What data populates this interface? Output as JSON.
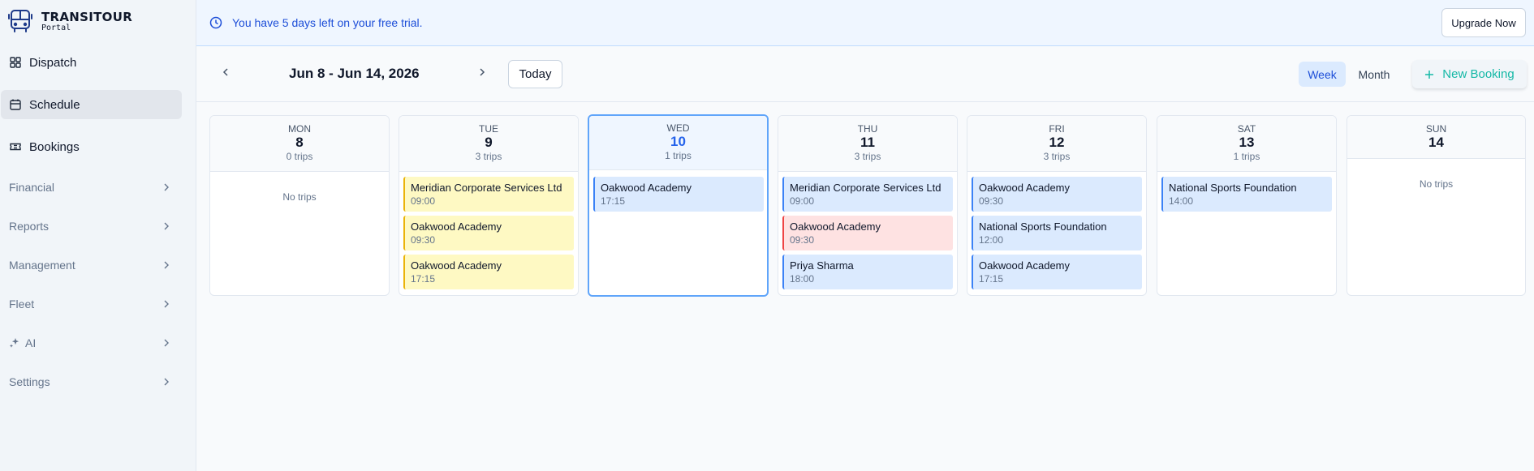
{
  "brand": {
    "title": "TRANSITOUR",
    "subtitle": "Portal"
  },
  "sidebar": {
    "items": [
      {
        "label": "Dispatch",
        "icon": "grid-icon"
      },
      {
        "label": "Schedule",
        "icon": "calendar-icon",
        "active": true
      },
      {
        "label": "Bookings",
        "icon": "ticket-icon"
      }
    ],
    "groups": [
      {
        "label": "Financial"
      },
      {
        "label": "Reports"
      },
      {
        "label": "Management"
      },
      {
        "label": "Fleet"
      },
      {
        "label": "AI",
        "icon": "sparkles-icon"
      },
      {
        "label": "Settings"
      }
    ]
  },
  "banner": {
    "text": "You have 5 days left on your free trial.",
    "button": "Upgrade Now"
  },
  "toolbar": {
    "range": "Jun 8 - Jun 14, 2026",
    "today": "Today",
    "views": [
      "Week",
      "Month"
    ],
    "active_view": "Week",
    "new_booking": "New Booking"
  },
  "empty_text": "No trips",
  "days": [
    {
      "name": "MON",
      "num": "8",
      "trips": "0 trips",
      "bookings": []
    },
    {
      "name": "TUE",
      "num": "9",
      "trips": "3 trips",
      "bookings": [
        {
          "client": "Meridian Corporate Services Ltd",
          "time": "09:00",
          "color": "yellow"
        },
        {
          "client": "Oakwood Academy",
          "time": "09:30",
          "color": "yellow"
        },
        {
          "client": "Oakwood Academy",
          "time": "17:15",
          "color": "yellow"
        }
      ]
    },
    {
      "name": "WED",
      "num": "10",
      "trips": "1 trips",
      "today": true,
      "bookings": [
        {
          "client": "Oakwood Academy",
          "time": "17:15",
          "color": "blue"
        }
      ]
    },
    {
      "name": "THU",
      "num": "11",
      "trips": "3 trips",
      "bookings": [
        {
          "client": "Meridian Corporate Services Ltd",
          "time": "09:00",
          "color": "blue"
        },
        {
          "client": "Oakwood Academy",
          "time": "09:30",
          "color": "red"
        },
        {
          "client": "Priya Sharma",
          "time": "18:00",
          "color": "blue"
        }
      ]
    },
    {
      "name": "FRI",
      "num": "12",
      "trips": "3 trips",
      "bookings": [
        {
          "client": "Oakwood Academy",
          "time": "09:30",
          "color": "blue"
        },
        {
          "client": "National Sports Foundation",
          "time": "12:00",
          "color": "blue"
        },
        {
          "client": "Oakwood Academy",
          "time": "17:15",
          "color": "blue"
        }
      ]
    },
    {
      "name": "SAT",
      "num": "13",
      "trips": "1 trips",
      "bookings": [
        {
          "client": "National Sports Foundation",
          "time": "14:00",
          "color": "blue"
        }
      ]
    },
    {
      "name": "SUN",
      "num": "14",
      "trips": "",
      "bookings": []
    }
  ],
  "colors": {
    "accent": "#2563eb",
    "teal": "#14b8a6",
    "yellow": "#fef9c3",
    "red": "#fee2e2",
    "blue": "#dbeafe"
  }
}
